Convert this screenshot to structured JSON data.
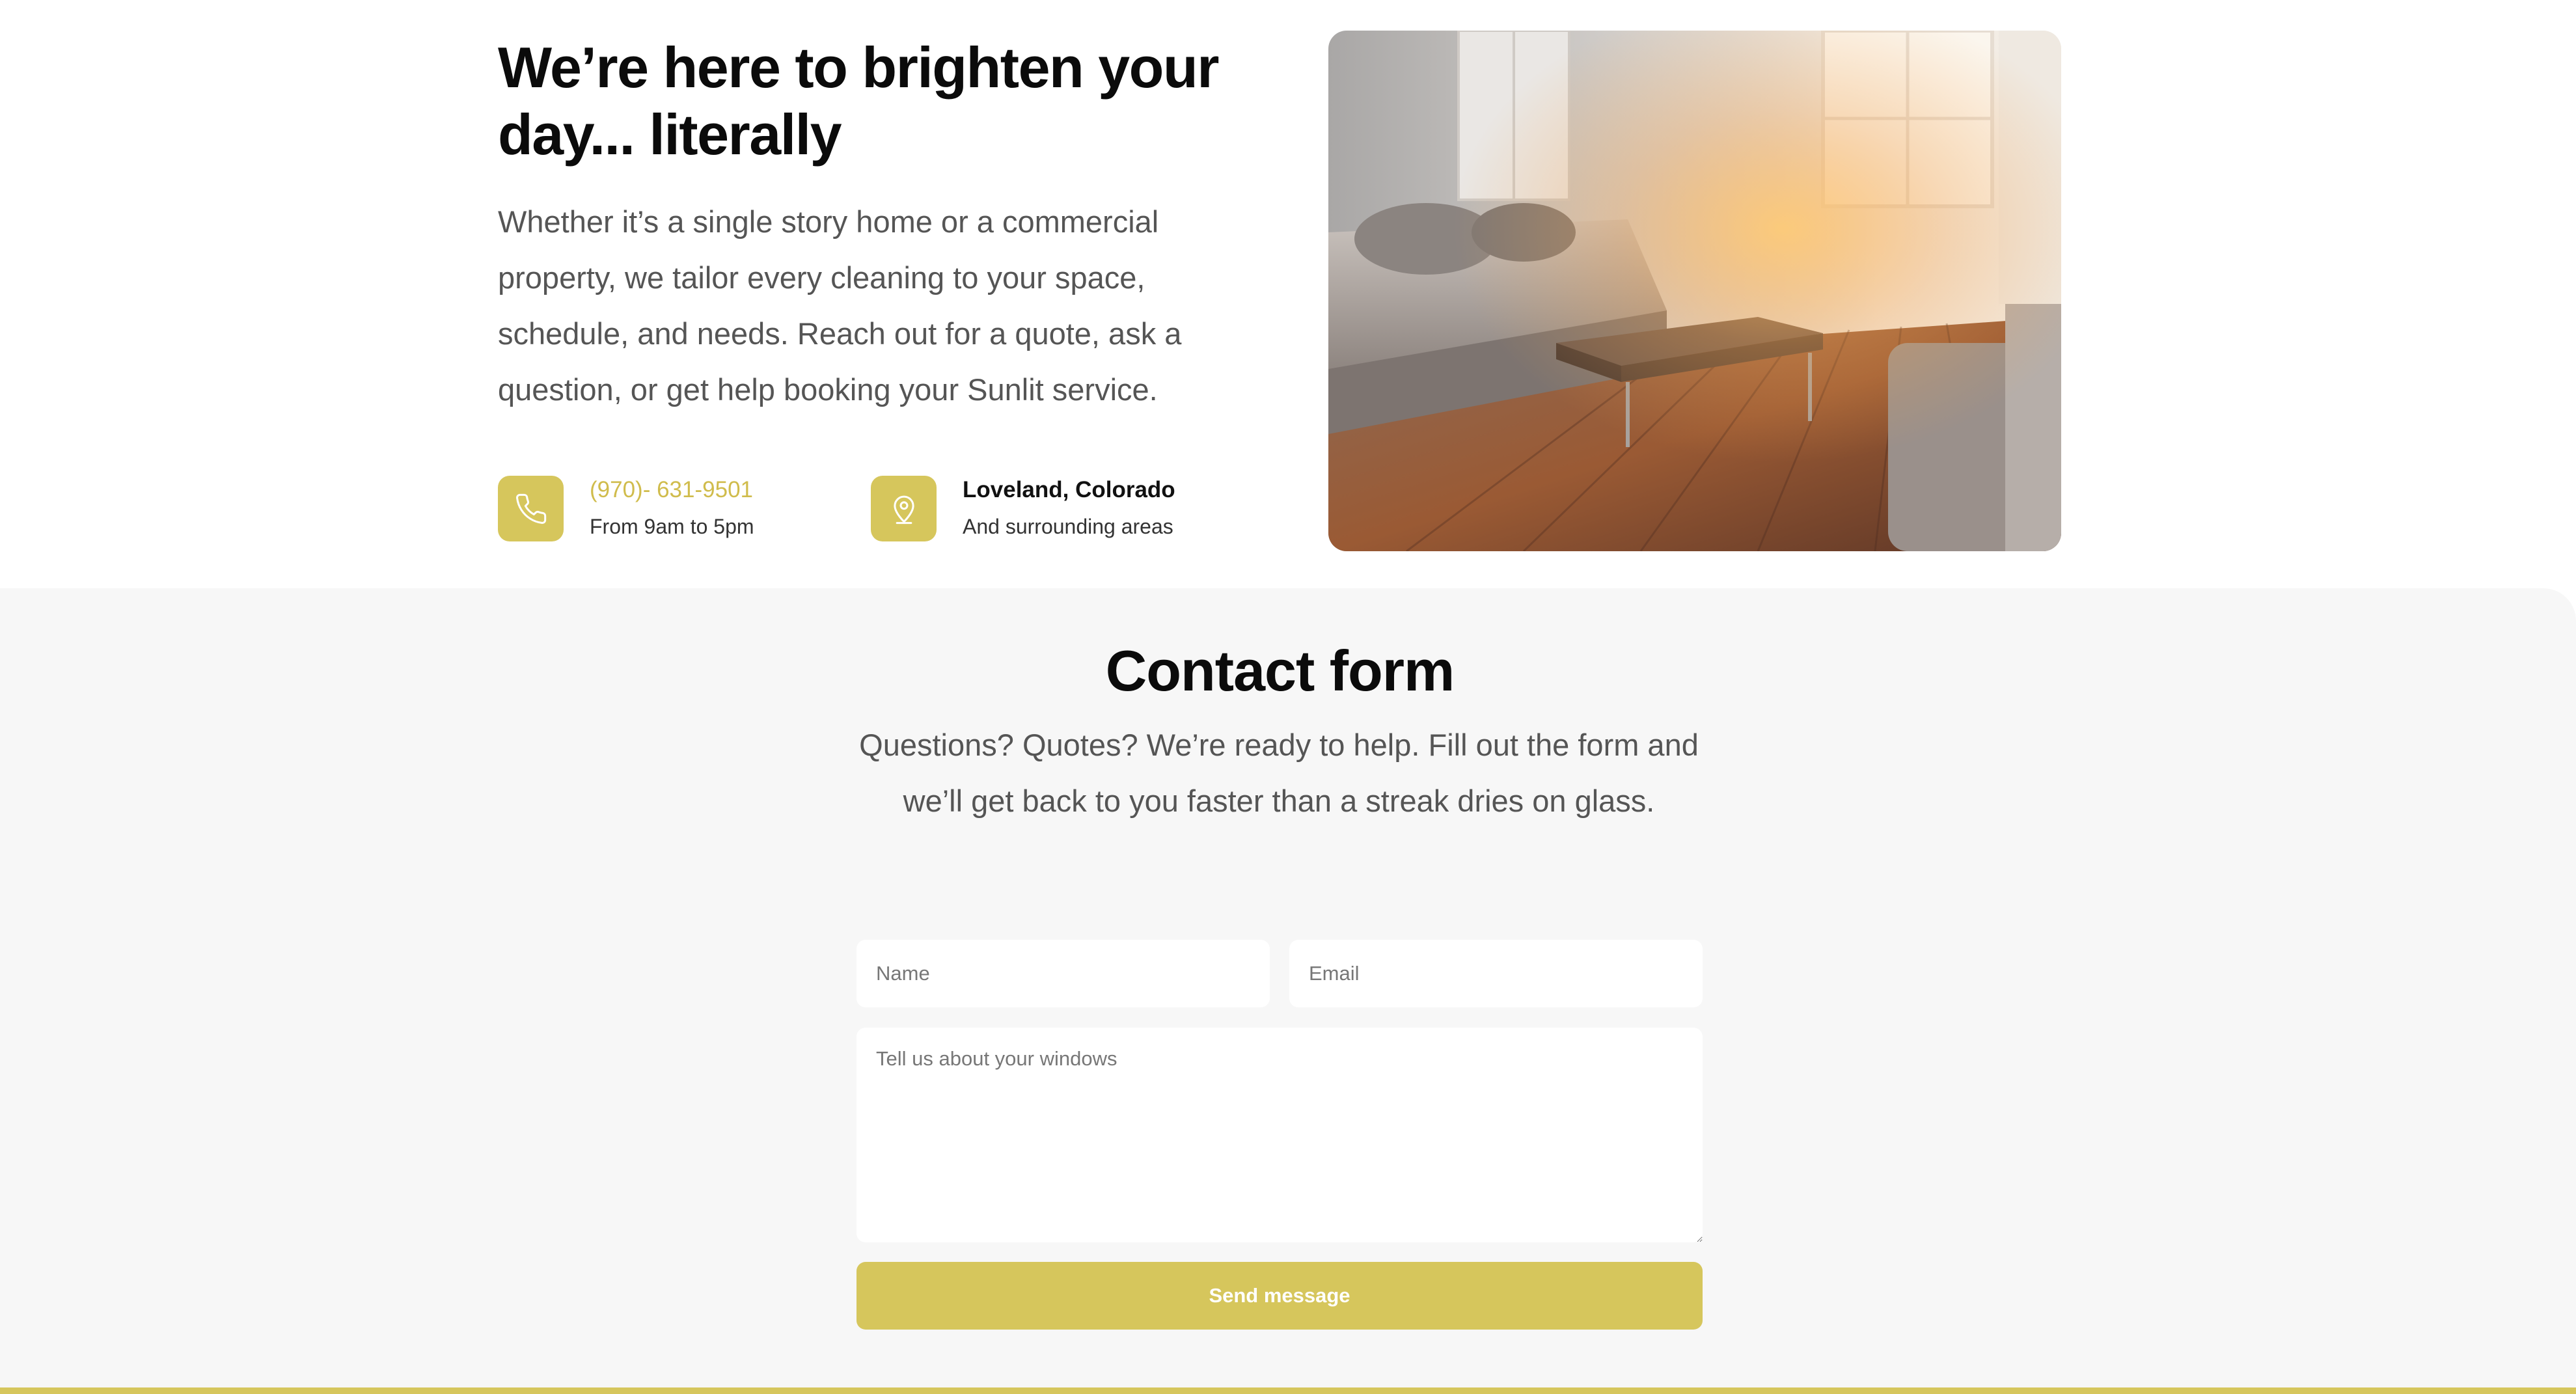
{
  "hero": {
    "title": "We’re here to brighten your day... literally",
    "text": "Whether it’s a single story home or a commercial property, we tailor every cleaning to your space, schedule, and needs. Reach out for a quote, ask a question, or get help booking your Sunlit service.",
    "phone": {
      "icon": "phone-icon",
      "number": "(970)- 631-9501",
      "hours": "From 9am to 5pm"
    },
    "location": {
      "icon": "map-pin-icon",
      "place": "Loveland, Colorado",
      "area": "And surrounding areas"
    }
  },
  "contact": {
    "title": "Contact form",
    "text": "Questions? Quotes? We’re ready to help. Fill out the form and we’ll get back to you faster than a streak dries on glass.",
    "form": {
      "name_placeholder": "Name",
      "name_value": "",
      "email_placeholder": "Email",
      "email_value": "",
      "message_placeholder": "Tell us about your windows",
      "message_value": "",
      "submit_label": "Send message"
    }
  },
  "colors": {
    "accent": "#d6c65c",
    "accent_text": "#d0bc4c",
    "section_bg": "#f7f7f7"
  }
}
